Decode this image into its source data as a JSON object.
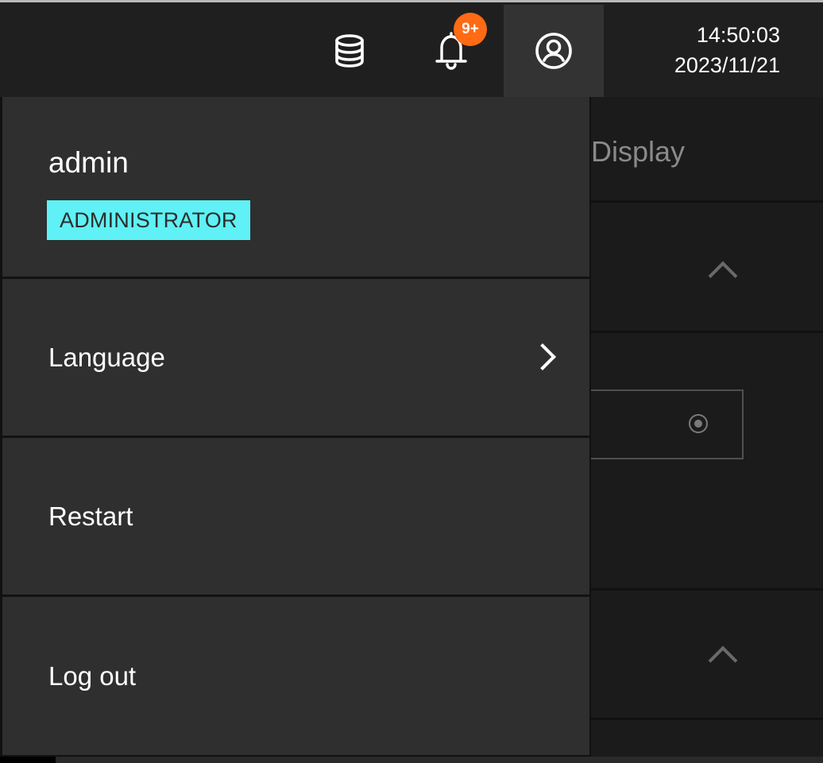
{
  "topbar": {
    "icons": {
      "database": "database-icon",
      "notifications": "bell-icon",
      "user": "user-circle-icon"
    },
    "notification_badge": "9+",
    "badge_color": "#ff6a14",
    "clock": {
      "time": "14:50:03",
      "date": "2023/11/21"
    }
  },
  "background": {
    "section_label": "Display"
  },
  "user_menu": {
    "username": "admin",
    "role": "ADMINISTRATOR",
    "role_color": "#5ff1f5",
    "items": [
      {
        "label": "Language",
        "has_submenu": true
      },
      {
        "label": "Restart",
        "has_submenu": false
      },
      {
        "label": "Log out",
        "has_submenu": false
      }
    ]
  }
}
